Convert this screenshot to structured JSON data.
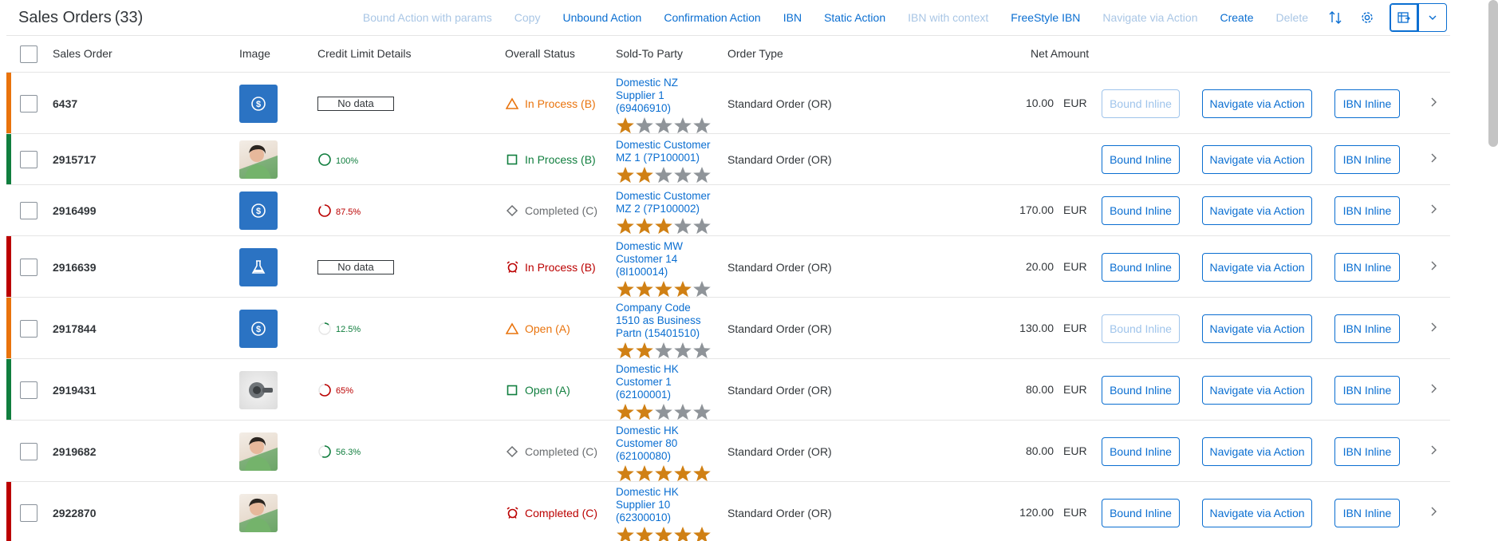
{
  "header": {
    "title": "Sales Orders",
    "count": "(33)"
  },
  "toolbar": {
    "actions": [
      {
        "label": "Bound Action with params",
        "disabled": true
      },
      {
        "label": "Copy",
        "disabled": true
      },
      {
        "label": "Unbound Action",
        "disabled": false
      },
      {
        "label": "Confirmation Action",
        "disabled": false
      },
      {
        "label": "IBN",
        "disabled": false
      },
      {
        "label": "Static Action",
        "disabled": false
      },
      {
        "label": "IBN with context",
        "disabled": true
      },
      {
        "label": "FreeStyle IBN",
        "disabled": false
      },
      {
        "label": "Navigate via Action",
        "disabled": true
      },
      {
        "label": "Create",
        "disabled": false
      },
      {
        "label": "Delete",
        "disabled": true
      }
    ],
    "icons": [
      "sort-icon",
      "settings-gear-icon",
      "export-spreadsheet-icon",
      "chevron-down-icon"
    ]
  },
  "columns": {
    "sales_order": "Sales Order",
    "image": "Image",
    "credit": "Credit Limit Details",
    "status": "Overall Status",
    "party": "Sold-To Party",
    "order_type": "Order Type",
    "net_amount": "Net Amount"
  },
  "row_buttons": {
    "bound": "Bound Inline",
    "navigate": "Navigate via Action",
    "ibn": "IBN Inline"
  },
  "colors": {
    "accent": "#0a6ed1",
    "warning": "#e9730c",
    "success": "#107e3e",
    "error": "#bb0000",
    "neutral": "#6a6d70",
    "star_filled": "#d08014",
    "star_empty": "#8f9499"
  },
  "rows": [
    {
      "id": "6437",
      "highlight": "#e9730c",
      "image": "money-icon",
      "credit": {
        "type": "nodata",
        "text": "No data"
      },
      "status": {
        "text": "In Process (B)",
        "icon": "warning-triangle-icon",
        "color": "#e9730c"
      },
      "party": [
        "Domestic NZ",
        "Supplier 1",
        "(69406910)"
      ],
      "rating": 1,
      "order_type": "Standard Order (OR)",
      "amount": "10.00",
      "currency": "EUR",
      "bound_disabled": true
    },
    {
      "id": "2915717",
      "highlight": "#107e3e",
      "image": "person-photo",
      "credit": {
        "type": "progress",
        "text": "100%",
        "value": 100,
        "color": "#107e3e"
      },
      "status": {
        "text": "In Process (B)",
        "icon": "square-icon",
        "color": "#107e3e"
      },
      "party": [
        "Domestic Customer",
        "MZ 1 (7P100001)"
      ],
      "rating": 2,
      "order_type": "Standard Order (OR)",
      "amount": "",
      "currency": "",
      "bound_disabled": false
    },
    {
      "id": "2916499",
      "highlight": "",
      "image": "money-icon",
      "credit": {
        "type": "progress",
        "text": "87.5%",
        "value": 87.5,
        "color": "#bb0000"
      },
      "status": {
        "text": "Completed (C)",
        "icon": "diamond-icon",
        "color": "#6a6d70"
      },
      "party": [
        "Domestic Customer",
        "MZ 2 (7P100002)"
      ],
      "rating": 3,
      "order_type": "",
      "amount": "170.00",
      "currency": "EUR",
      "bound_disabled": false
    },
    {
      "id": "2916639",
      "highlight": "#bb0000",
      "image": "lab-flask-icon",
      "credit": {
        "type": "nodata",
        "text": "No data"
      },
      "status": {
        "text": "In Process (B)",
        "icon": "alarm-icon",
        "color": "#bb0000"
      },
      "party": [
        "Domestic MW",
        "Customer 14",
        "(8I100014)"
      ],
      "rating": 4,
      "order_type": "Standard Order (OR)",
      "amount": "20.00",
      "currency": "EUR",
      "bound_disabled": false
    },
    {
      "id": "2917844",
      "highlight": "#e9730c",
      "image": "money-icon",
      "credit": {
        "type": "progress",
        "text": "12.5%",
        "value": 12.5,
        "color": "#107e3e"
      },
      "status": {
        "text": "Open (A)",
        "icon": "warning-triangle-icon",
        "color": "#e9730c"
      },
      "party": [
        "Company Code",
        "1510 as Business",
        "Partn (15401510)"
      ],
      "rating": 2,
      "order_type": "Standard Order (OR)",
      "amount": "130.00",
      "currency": "EUR",
      "bound_disabled": true
    },
    {
      "id": "2919431",
      "highlight": "#107e3e",
      "image": "product-photo",
      "credit": {
        "type": "progress",
        "text": "65%",
        "value": 65,
        "color": "#bb0000"
      },
      "status": {
        "text": "Open (A)",
        "icon": "square-icon",
        "color": "#107e3e"
      },
      "party": [
        "Domestic HK",
        "Customer 1",
        "(62100001)"
      ],
      "rating": 2,
      "order_type": "Standard Order (OR)",
      "amount": "80.00",
      "currency": "EUR",
      "bound_disabled": false
    },
    {
      "id": "2919682",
      "highlight": "",
      "image": "person-photo",
      "credit": {
        "type": "progress",
        "text": "56.3%",
        "value": 56.3,
        "color": "#107e3e"
      },
      "status": {
        "text": "Completed (C)",
        "icon": "diamond-icon",
        "color": "#6a6d70"
      },
      "party": [
        "Domestic HK",
        "Customer 80",
        "(62100080)"
      ],
      "rating": 5,
      "order_type": "Standard Order (OR)",
      "amount": "80.00",
      "currency": "EUR",
      "bound_disabled": false
    },
    {
      "id": "2922870",
      "highlight": "#bb0000",
      "image": "person-photo",
      "credit": {
        "type": "none",
        "text": ""
      },
      "status": {
        "text": "Completed (C)",
        "icon": "alarm-icon",
        "color": "#bb0000"
      },
      "party": [
        "Domestic HK",
        "Supplier 10",
        "(62300010)"
      ],
      "rating": 5,
      "order_type": "Standard Order (OR)",
      "amount": "120.00",
      "currency": "EUR",
      "bound_disabled": false
    }
  ]
}
